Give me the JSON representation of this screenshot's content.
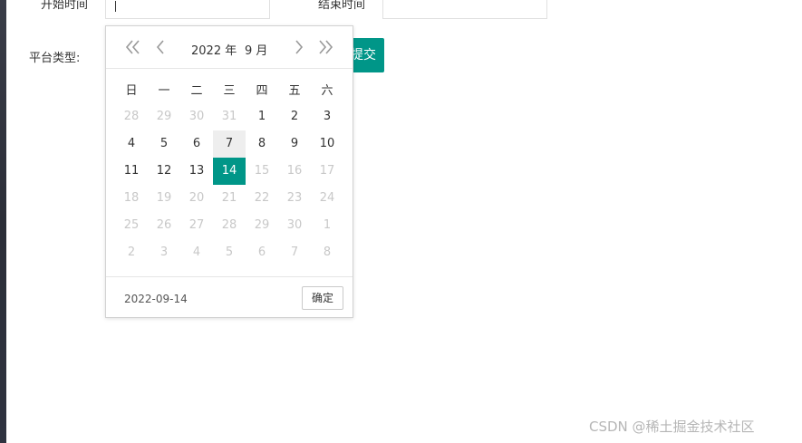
{
  "form": {
    "start_label": "开始时间",
    "end_label": "结束时间",
    "platform_label": "平台类型:",
    "submit_label": "提交"
  },
  "picker": {
    "year": "2022 年",
    "month": "9 月",
    "weekdays": [
      "日",
      "一",
      "二",
      "三",
      "四",
      "五",
      "六"
    ],
    "weeks": [
      [
        "28",
        "29",
        "30",
        "31",
        "1",
        "2",
        "3"
      ],
      [
        "4",
        "5",
        "6",
        "7",
        "8",
        "9",
        "10"
      ],
      [
        "11",
        "12",
        "13",
        "14",
        "15",
        "16",
        "17"
      ],
      [
        "18",
        "19",
        "20",
        "21",
        "22",
        "23",
        "24"
      ],
      [
        "25",
        "26",
        "27",
        "28",
        "29",
        "30",
        "1"
      ],
      [
        "2",
        "3",
        "4",
        "5",
        "6",
        "7",
        "8"
      ]
    ],
    "footer_date": "2022-09-14",
    "confirm_label": "确定"
  },
  "watermark": "CSDN @稀土掘金技术社区"
}
